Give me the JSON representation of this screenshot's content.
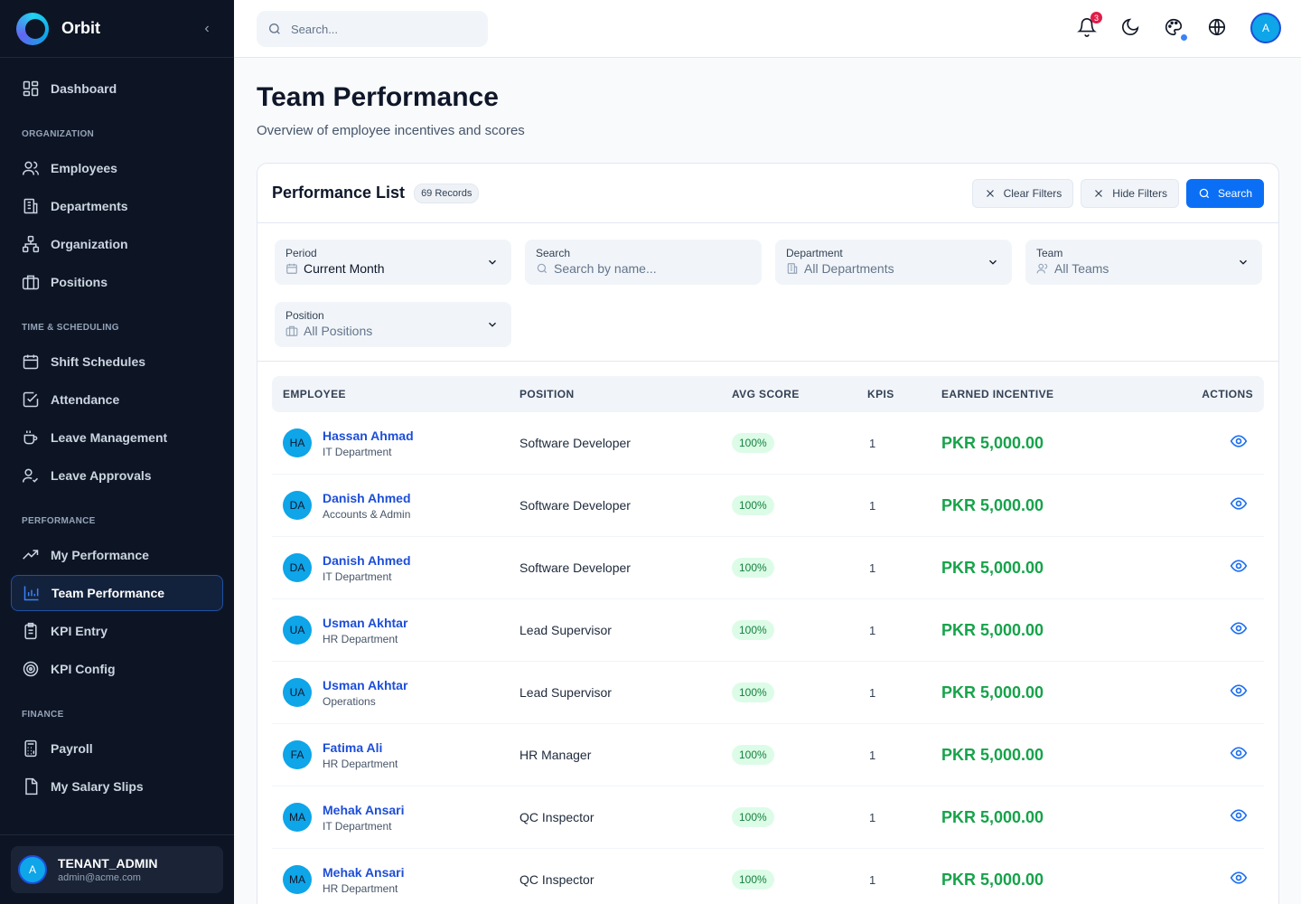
{
  "app": {
    "name": "Orbit"
  },
  "sidebar": {
    "dashboard": "Dashboard",
    "sections": {
      "organization": "ORGANIZATION",
      "time": "TIME & SCHEDULING",
      "performance": "PERFORMANCE",
      "finance": "FINANCE"
    },
    "items": {
      "employees": "Employees",
      "departments": "Departments",
      "organization": "Organization",
      "positions": "Positions",
      "shift_schedules": "Shift Schedules",
      "attendance": "Attendance",
      "leave_management": "Leave Management",
      "leave_approvals": "Leave Approvals",
      "my_performance": "My Performance",
      "team_performance": "Team Performance",
      "kpi_entry": "KPI Entry",
      "kpi_config": "KPI Config",
      "payroll": "Payroll",
      "my_salary_slips": "My Salary Slips"
    },
    "user": {
      "initial": "A",
      "name": "TENANT_ADMIN",
      "email": "admin@acme.com"
    }
  },
  "topbar": {
    "search_placeholder": "Search...",
    "notification_count": "3",
    "avatar_initial": "A"
  },
  "page": {
    "title": "Team Performance",
    "subtitle": "Overview of employee incentives and scores"
  },
  "list": {
    "title": "Performance List",
    "records": "69 Records",
    "clear_filters": "Clear Filters",
    "hide_filters": "Hide Filters",
    "search": "Search"
  },
  "filters": {
    "period": {
      "label": "Period",
      "value": "Current Month"
    },
    "search": {
      "label": "Search",
      "placeholder": "Search by name..."
    },
    "department": {
      "label": "Department",
      "value": "All Departments"
    },
    "team": {
      "label": "Team",
      "value": "All Teams"
    },
    "position": {
      "label": "Position",
      "value": "All Positions"
    }
  },
  "table": {
    "headers": {
      "employee": "EMPLOYEE",
      "position": "POSITION",
      "avg_score": "AVG SCORE",
      "kpis": "KPIS",
      "earned_incentive": "EARNED INCENTIVE",
      "actions": "ACTIONS"
    },
    "rows": [
      {
        "initials": "HA",
        "name": "Hassan Ahmad",
        "dept": "IT Department",
        "position": "Software Developer",
        "score": "100%",
        "kpis": "1",
        "incentive": "PKR 5,000.00"
      },
      {
        "initials": "DA",
        "name": "Danish Ahmed",
        "dept": "Accounts & Admin",
        "position": "Software Developer",
        "score": "100%",
        "kpis": "1",
        "incentive": "PKR 5,000.00"
      },
      {
        "initials": "DA",
        "name": "Danish Ahmed",
        "dept": "IT Department",
        "position": "Software Developer",
        "score": "100%",
        "kpis": "1",
        "incentive": "PKR 5,000.00"
      },
      {
        "initials": "UA",
        "name": "Usman Akhtar",
        "dept": "HR Department",
        "position": "Lead Supervisor",
        "score": "100%",
        "kpis": "1",
        "incentive": "PKR 5,000.00"
      },
      {
        "initials": "UA",
        "name": "Usman Akhtar",
        "dept": "Operations",
        "position": "Lead Supervisor",
        "score": "100%",
        "kpis": "1",
        "incentive": "PKR 5,000.00"
      },
      {
        "initials": "FA",
        "name": "Fatima Ali",
        "dept": "HR Department",
        "position": "HR Manager",
        "score": "100%",
        "kpis": "1",
        "incentive": "PKR 5,000.00"
      },
      {
        "initials": "MA",
        "name": "Mehak Ansari",
        "dept": "IT Department",
        "position": "QC Inspector",
        "score": "100%",
        "kpis": "1",
        "incentive": "PKR 5,000.00"
      },
      {
        "initials": "MA",
        "name": "Mehak Ansari",
        "dept": "HR Department",
        "position": "QC Inspector",
        "score": "100%",
        "kpis": "1",
        "incentive": "PKR 5,000.00"
      }
    ]
  },
  "colors": {
    "accent": "#0b6ff5",
    "sidebar_bg": "#0d1524",
    "success": "#16a34a"
  }
}
